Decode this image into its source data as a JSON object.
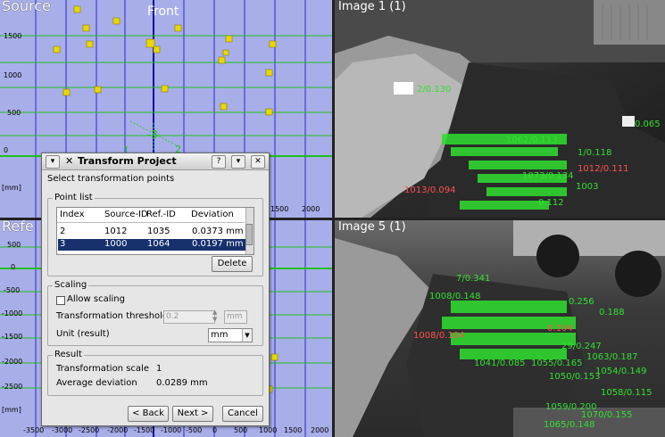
{
  "views": {
    "source_title": "Source",
    "front_label": "Front",
    "reference_title": "Refe",
    "source_y_ticks": [
      "1500",
      "1000",
      "500",
      "0"
    ],
    "source_x_ticks": [
      "1500",
      "2000"
    ],
    "unit_label": "[mm]",
    "reference_y_ticks": [
      "500",
      "0",
      "-500",
      "-1000",
      "-1500",
      "-2000",
      "-2500"
    ],
    "reference_x_ticks": [
      "-3500",
      "-3000",
      "-2500",
      "-2000",
      "-1500",
      "-1000",
      "-500",
      "0",
      "500",
      "1000",
      "1500",
      "2000"
    ]
  },
  "images": {
    "image1_title": "Image 1 (1)",
    "image5_title": "Image 5 (1)",
    "image1_labels": [
      {
        "text": "2/0.130",
        "color": "green"
      },
      {
        "text": "1013/0.094",
        "color": "red"
      },
      {
        "text": "1012/0.111",
        "color": "red"
      },
      {
        "text": "1/0.118",
        "color": "green"
      },
      {
        "text": "0.065",
        "color": "green"
      },
      {
        "text": "1003",
        "color": "green"
      },
      {
        "text": "0.112",
        "color": "green"
      },
      {
        "text": "1062/0.113",
        "color": "green"
      },
      {
        "text": "1073/0.134",
        "color": "green"
      }
    ],
    "image5_labels": [
      {
        "text": "7/0.341",
        "color": "green"
      },
      {
        "text": "1008/0.148",
        "color": "green"
      },
      {
        "text": "1008/0.104",
        "color": "red"
      },
      {
        "text": "0.104",
        "color": "red"
      },
      {
        "text": "29/0.247",
        "color": "green"
      },
      {
        "text": "1063/0.187",
        "color": "green"
      },
      {
        "text": "1041/0.085",
        "color": "green"
      },
      {
        "text": "1055/0.165",
        "color": "green"
      },
      {
        "text": "1054/0.149",
        "color": "green"
      },
      {
        "text": "1050/0.153",
        "color": "green"
      },
      {
        "text": "1058/0.115",
        "color": "green"
      },
      {
        "text": "1059/0.200",
        "color": "green"
      },
      {
        "text": "1070/0.155",
        "color": "green"
      },
      {
        "text": "1065/0.148",
        "color": "green"
      },
      {
        "text": "0.188",
        "color": "green"
      },
      {
        "text": "0.256",
        "color": "green"
      }
    ]
  },
  "dialog": {
    "title": "Transform Project",
    "help_btn": "?",
    "subtitle": "Select transformation points",
    "point_list_label": "Point list",
    "columns": [
      "Index",
      "Source-ID",
      "Ref.-ID",
      "Deviation"
    ],
    "rows": [
      {
        "index": "2",
        "source_id": "1012",
        "ref_id": "1035",
        "deviation": "0.0373 mm",
        "selected": false
      },
      {
        "index": "3",
        "source_id": "1000",
        "ref_id": "1064",
        "deviation": "0.0197 mm",
        "selected": true
      }
    ],
    "delete_btn": "Delete",
    "scaling_label": "Scaling",
    "allow_scaling": "Allow scaling",
    "threshold_label": "Transformation threshold",
    "threshold_value": "0.2",
    "threshold_unit": "mm",
    "unit_label": "Unit (result)",
    "unit_value": "mm",
    "result_label": "Result",
    "scale_label": "Transformation scale",
    "scale_value": "1",
    "avg_dev_label": "Average deviation",
    "avg_dev_value": "0.0289 mm",
    "back_btn": "< Back",
    "next_btn": "Next >",
    "cancel_btn": "Cancel"
  }
}
